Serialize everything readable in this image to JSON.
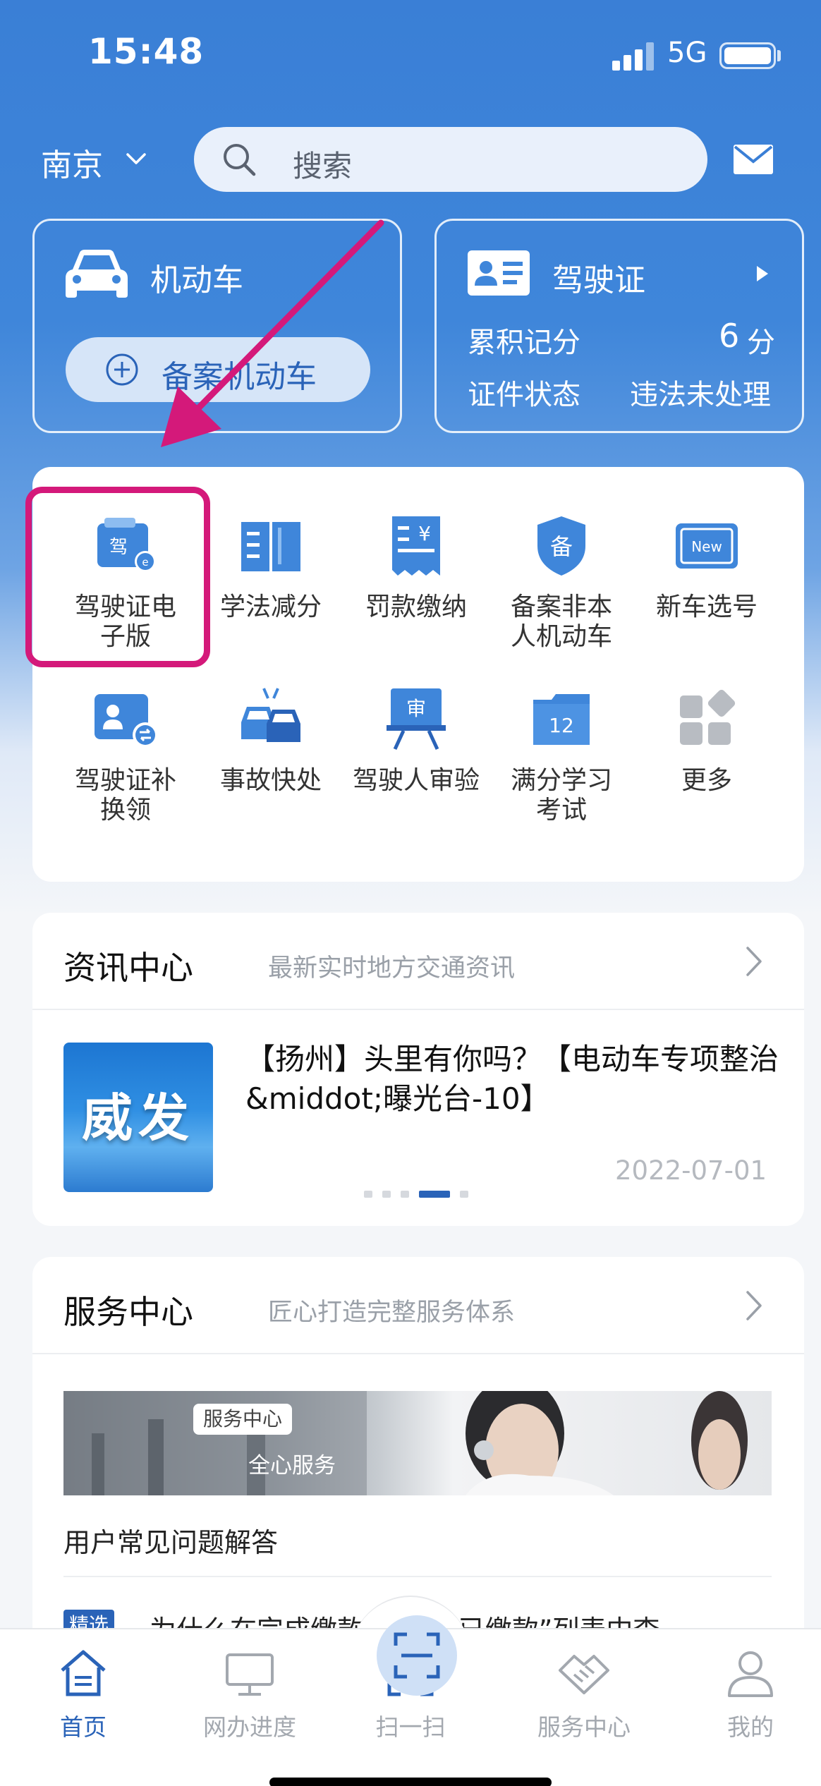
{
  "status_bar": {
    "time": "15:48",
    "network": "5G"
  },
  "header": {
    "city": "南京",
    "search_placeholder": "搜索"
  },
  "vehicle_card": {
    "title": "机动车",
    "add_button": "备案机动车"
  },
  "license_card": {
    "title": "驾驶证",
    "points_label": "累积记分",
    "points_value": "6",
    "points_unit": "分",
    "status_label": "证件状态",
    "status_value": "违法未处理"
  },
  "services": [
    {
      "line1": "驾驶证电",
      "line2": "子版",
      "icon": "e-license-icon"
    },
    {
      "line1": "学法减分",
      "line2": "",
      "icon": "book-icon"
    },
    {
      "line1": "罚款缴纳",
      "line2": "",
      "icon": "fine-receipt-icon",
      "glyph": "¥"
    },
    {
      "line1": "备案非本",
      "line2": "人机动车",
      "icon": "record-shield-icon",
      "glyph": "备"
    },
    {
      "line1": "新车选号",
      "line2": "",
      "icon": "new-plate-icon",
      "glyph": "New"
    },
    {
      "line1": "驾驶证补",
      "line2": "换领",
      "icon": "license-exchange-icon"
    },
    {
      "line1": "事故快处",
      "line2": "",
      "icon": "accident-cars-icon"
    },
    {
      "line1": "驾驶人审验",
      "line2": "",
      "icon": "review-board-icon",
      "glyph": "审"
    },
    {
      "line1": "满分学习",
      "line2": "考试",
      "icon": "exam-folder-icon",
      "glyph": "12"
    },
    {
      "line1": "更多",
      "line2": "",
      "icon": "more-grid-icon"
    }
  ],
  "service_glyphs": {
    "license": "驾"
  },
  "news": {
    "title": "资讯中心",
    "subtitle": "最新实时地方交通资讯",
    "thumb_text": "威发",
    "headline": "【扬州】头里有你吗？【电动车专项整治&middot;曝光台-10】",
    "date": "2022-07-01"
  },
  "service_center": {
    "title": "服务中心",
    "subtitle": "匠心打造完整服务体系",
    "banner_tag": "服务中心",
    "banner_sub": "全心服务",
    "faq_title": "用户常见问题解答",
    "faq_tag": "精选",
    "faq_question": "为什么在完成缴款后还在“已缴款”列表中查"
  },
  "tabbar": [
    {
      "label": "首页",
      "icon": "home-icon",
      "active": true
    },
    {
      "label": "网办进度",
      "icon": "monitor-icon",
      "active": false
    },
    {
      "label": "扫一扫",
      "icon": "scan-icon",
      "active": false
    },
    {
      "label": "服务中心",
      "icon": "handshake-icon",
      "active": false
    },
    {
      "label": "我的",
      "icon": "user-icon",
      "active": false
    }
  ],
  "colors": {
    "primary": "#2a63b8",
    "header_blue": "#3a7fd6",
    "annotation": "#d4197a"
  }
}
